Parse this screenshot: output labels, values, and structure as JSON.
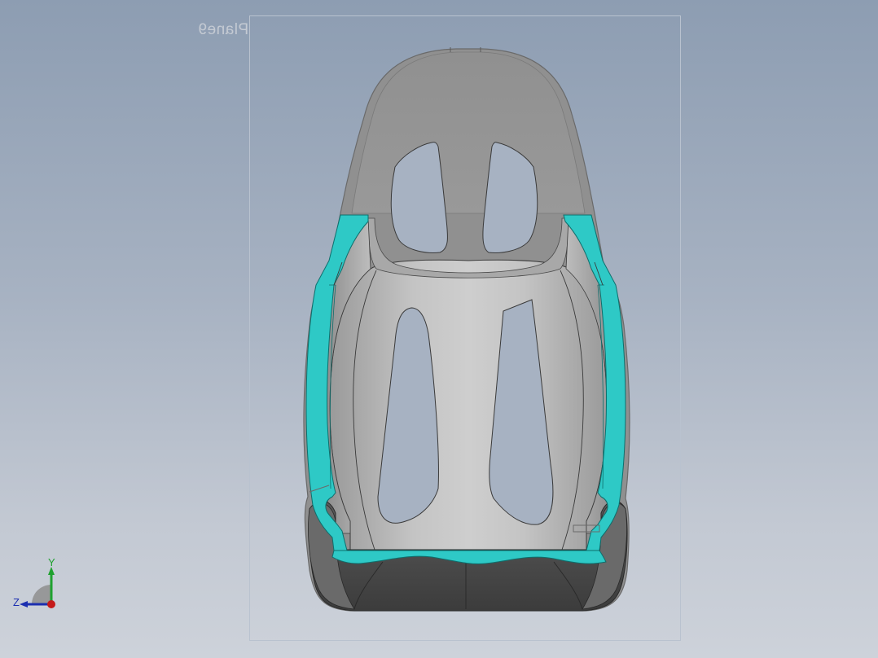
{
  "viewport": {
    "plane_label": "Plane9",
    "background_top": "#8d9db2",
    "background_bottom": "#cdd2da"
  },
  "triad": {
    "y_label": "Y",
    "z_label": "Z",
    "y_color": "#1fa12f",
    "z_color": "#1c2fb0",
    "x_color": "#c51a1a"
  },
  "model": {
    "shell_color": "#8c8c8c",
    "inner_color": "#c6c6c6",
    "section_color": "#2ec9c6",
    "cushion_color": "#4e4e4e"
  }
}
